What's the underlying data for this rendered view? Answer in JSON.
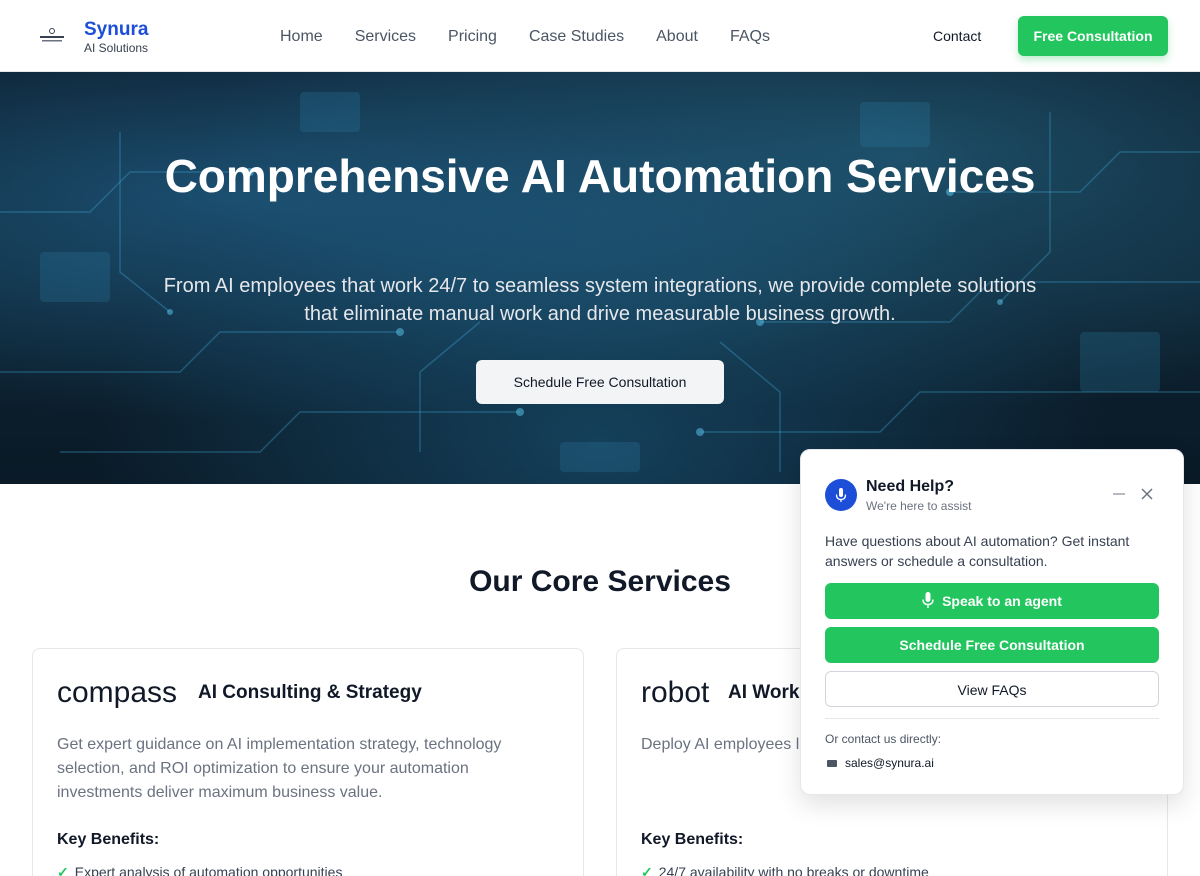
{
  "header": {
    "logo_alt": "Synura logo",
    "brand_name": "Synura",
    "brand_sub": "AI Solutions",
    "nav": [
      "Home",
      "Services",
      "Pricing",
      "Case Studies",
      "About",
      "FAQs"
    ],
    "contact_label": "Contact",
    "cta_label": "Free Consultation"
  },
  "hero": {
    "title": "Comprehensive AI Automation Services",
    "subtitle": "From AI employees that work 24/7 to seamless system integrations, we provide complete solutions that eliminate manual work and drive measurable business growth.",
    "cta_label": "Schedule Free Consultation"
  },
  "services": {
    "title": "Our Core Services",
    "benefits_label": "Key Benefits:",
    "cards": [
      {
        "icon": "compass",
        "title": "AI Consulting & Strategy",
        "description": "Get expert guidance on AI implementation strategy, technology selection, and ROI optimization to ensure your automation investments deliver maximum business value.",
        "benefit": "Expert analysis of automation opportunities"
      },
      {
        "icon": "robot",
        "title": "AI Work",
        "description": "Deploy AI employees lead qualification, dat human-level accuracy.",
        "benefit": "24/7 availability with no breaks or downtime"
      }
    ]
  },
  "help_widget": {
    "title": "Need Help?",
    "subtitle": "We're here to assist",
    "text": "Have questions about AI automation? Get instant answers or schedule a consultation.",
    "speak_label": "Speak to an agent",
    "schedule_label": "Schedule Free Consultation",
    "faq_label": "View FAQs",
    "contact_intro": "Or contact us directly:",
    "email": "sales@synura.ai"
  },
  "colors": {
    "brand_blue": "#1d4ed8",
    "accent_green": "#22c55e",
    "hero_bg": "#0d2231"
  }
}
